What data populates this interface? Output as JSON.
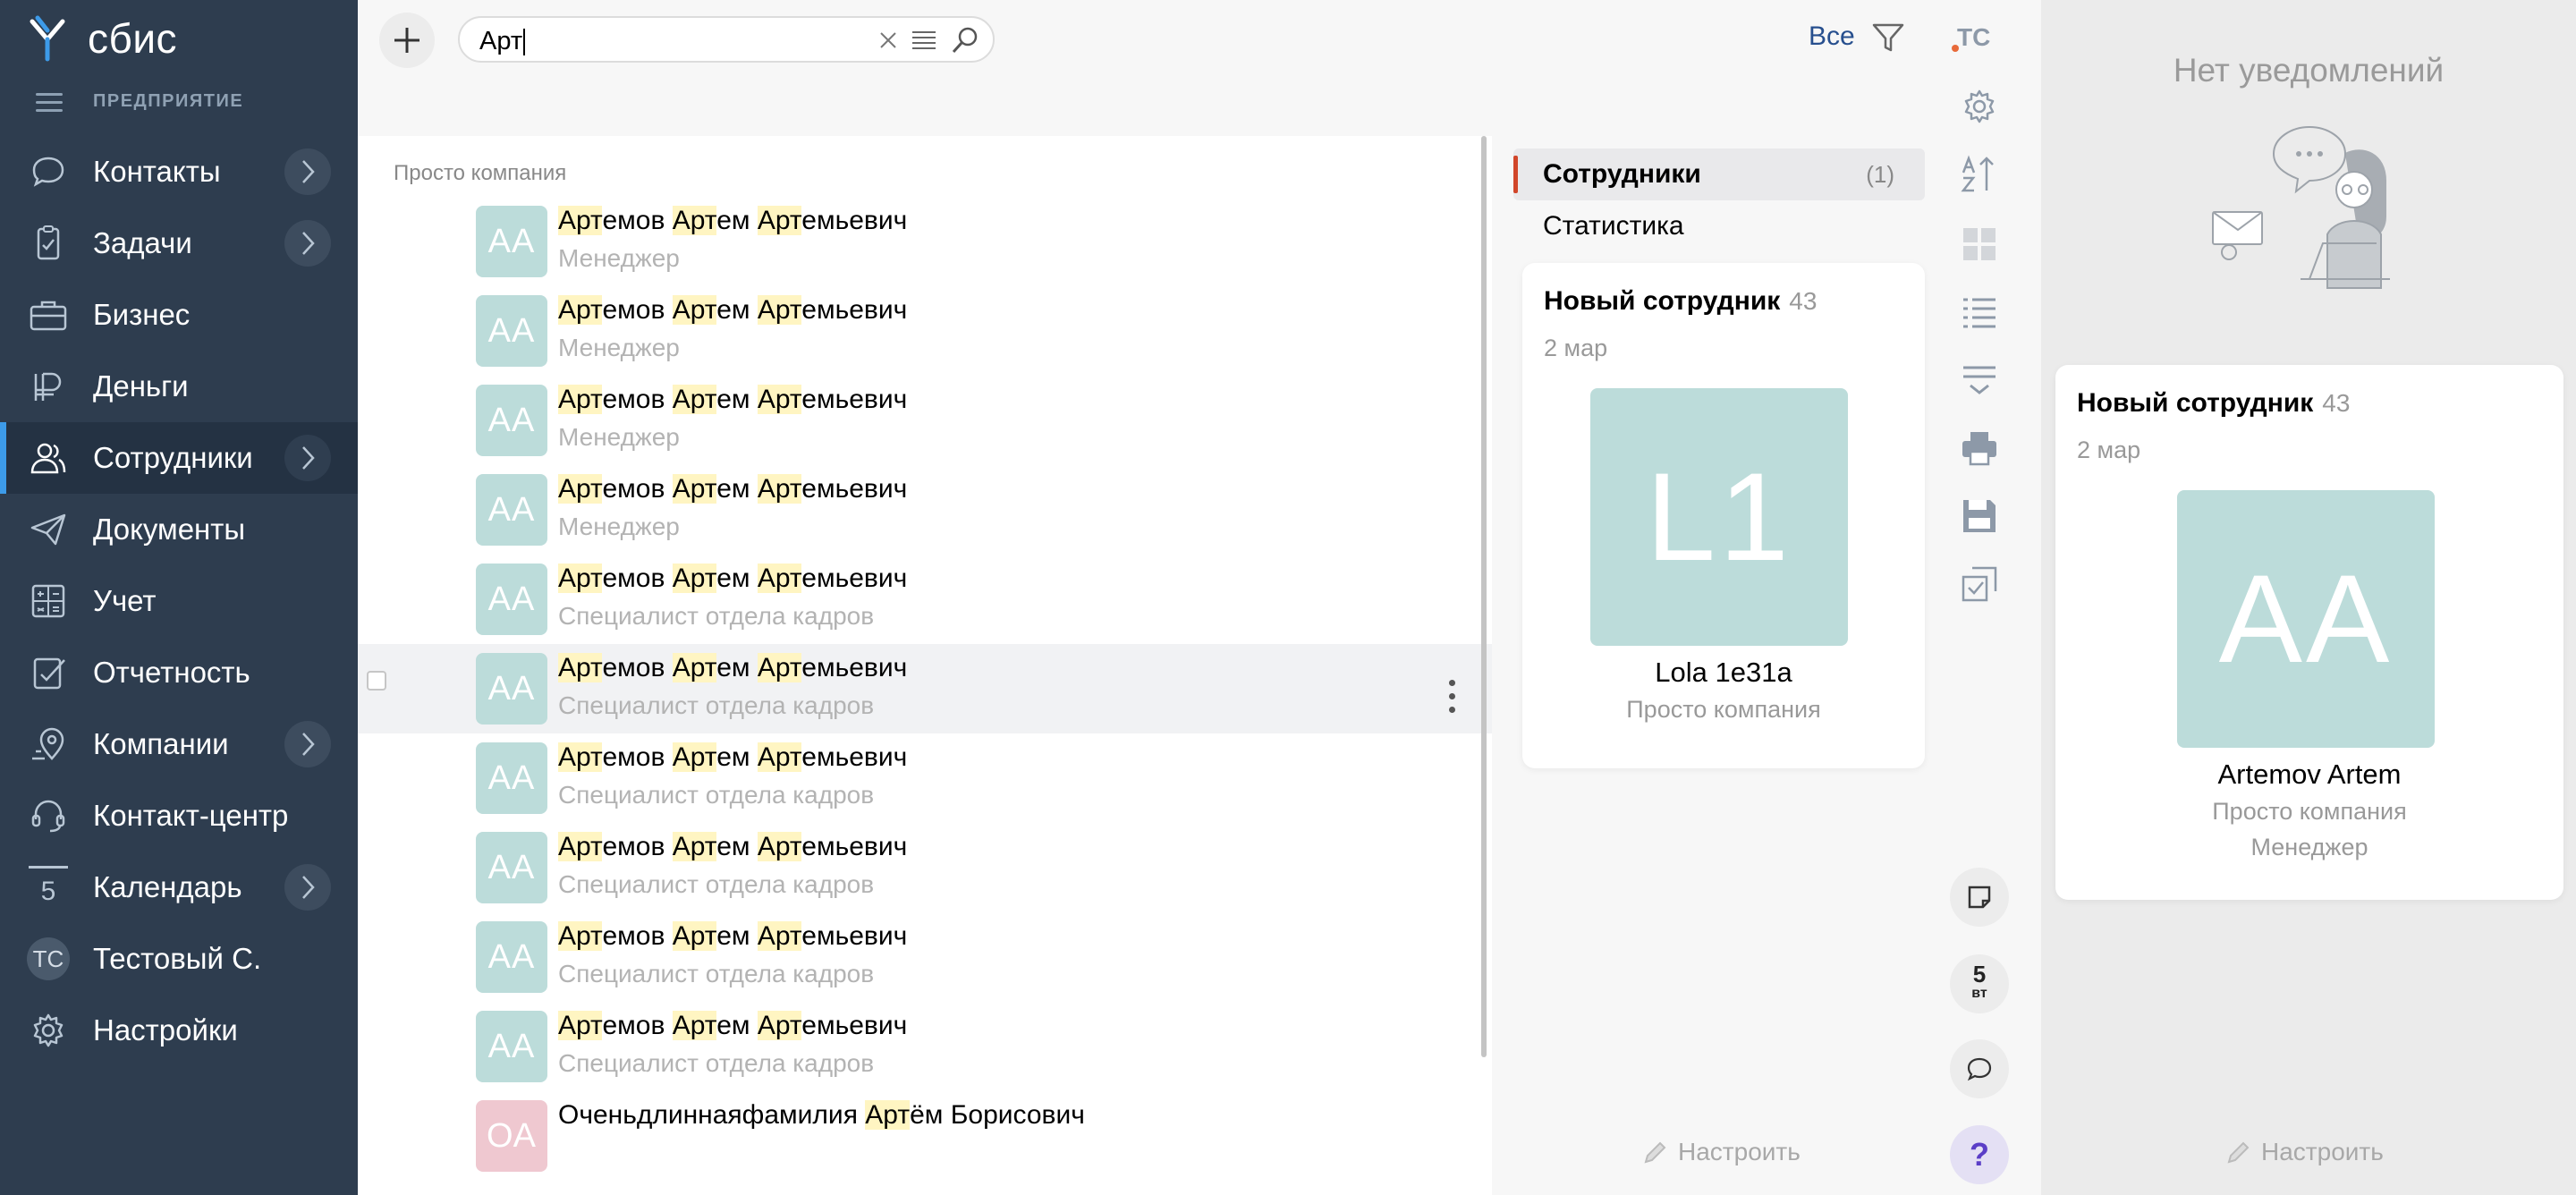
{
  "brand": {
    "logo_text": "сбис",
    "accent_color": "#3d9be9"
  },
  "sidebar": {
    "section_label": "ПРЕДПРИЯТИЕ",
    "items": [
      {
        "label": "Контакты",
        "icon": "chat-icon",
        "has_arrow": true
      },
      {
        "label": "Задачи",
        "icon": "clipboard-check-icon",
        "has_arrow": true
      },
      {
        "label": "Бизнес",
        "icon": "briefcase-icon",
        "has_arrow": false
      },
      {
        "label": "Деньги",
        "icon": "ruble-icon",
        "has_arrow": false
      },
      {
        "label": "Сотрудники",
        "icon": "people-icon",
        "has_arrow": true,
        "active": true
      },
      {
        "label": "Документы",
        "icon": "paper-plane-icon",
        "has_arrow": false
      },
      {
        "label": "Учет",
        "icon": "calculator-icon",
        "has_arrow": false
      },
      {
        "label": "Отчетность",
        "icon": "report-icon",
        "has_arrow": false
      },
      {
        "label": "Компании",
        "icon": "map-pin-icon",
        "has_arrow": true
      },
      {
        "label": "Контакт-центр",
        "icon": "headset-icon",
        "has_arrow": false
      },
      {
        "label": "Календарь",
        "icon": "calendar-icon",
        "has_arrow": true,
        "calendar_day": "5"
      },
      {
        "label": "Тестовый С.",
        "icon": "avatar",
        "has_arrow": false,
        "initials": "ТС"
      },
      {
        "label": "Настройки",
        "icon": "gear-icon",
        "has_arrow": false
      }
    ]
  },
  "search": {
    "value": "Арт",
    "query": "Арт"
  },
  "filter": {
    "label": "Все"
  },
  "list": {
    "group_title": "Просто компания",
    "rows": [
      {
        "initials": "АА",
        "name": "Артемов Артем Артемьевич",
        "position": "Менеджер",
        "avatar_color": "#bcdcda"
      },
      {
        "initials": "АА",
        "name": "Артемов Артем Артемьевич",
        "position": "Менеджер",
        "avatar_color": "#bcdcda"
      },
      {
        "initials": "АА",
        "name": "Артемов Артем Артемьевич",
        "position": "Менеджер",
        "avatar_color": "#bcdcda"
      },
      {
        "initials": "АА",
        "name": "Артемов Артем Артемьевич",
        "position": "Менеджер",
        "avatar_color": "#bcdcda"
      },
      {
        "initials": "АА",
        "name": "Артемов Артем Артемьевич",
        "position": "Специалист отдела кадров",
        "avatar_color": "#bcdcda"
      },
      {
        "initials": "АА",
        "name": "Артемов Артем Артемьевич",
        "position": "Специалист отдела кадров",
        "avatar_color": "#bcdcda",
        "hover": true
      },
      {
        "initials": "АА",
        "name": "Артемов Артем Артемьевич",
        "position": "Специалист отдела кадров",
        "avatar_color": "#bcdcda"
      },
      {
        "initials": "АА",
        "name": "Артемов Артем Артемьевич",
        "position": "Специалист отдела кадров",
        "avatar_color": "#bcdcda"
      },
      {
        "initials": "АА",
        "name": "Артемов Артем Артемьевич",
        "position": "Специалист отдела кадров",
        "avatar_color": "#bcdcda"
      },
      {
        "initials": "АА",
        "name": "Артемов Артем Артемьевич",
        "position": "Специалист отдела кадров",
        "avatar_color": "#bcdcda"
      },
      {
        "initials": "ОА",
        "name": "Оченьдлиннаяфамилия Артём Борисович",
        "position": "",
        "avatar_color": "#efc8d0"
      }
    ]
  },
  "tabs": [
    {
      "label": "Сотрудники",
      "count": "(1)",
      "active": true
    },
    {
      "label": "Статистика",
      "count": "",
      "active": false
    }
  ],
  "new_employee_card": {
    "title": "Новый сотрудник",
    "count": "43",
    "date": "2 мар",
    "photo_text": "L1",
    "name": "Lola 1e31a",
    "company": "Просто компания"
  },
  "configure_label": "Настроить",
  "toolbar": {
    "initials": "ТС",
    "calendar_day": "5",
    "calendar_weekday": "вт",
    "help": "?"
  },
  "notifications": {
    "empty_title": "Нет уведомлений",
    "card": {
      "title": "Новый сотрудник",
      "count": "43",
      "date": "2 мар",
      "photo_text": "AA",
      "name": "Artemov Artem",
      "company": "Просто компания",
      "position": "Менеджер"
    },
    "configure_label": "Настроить"
  }
}
